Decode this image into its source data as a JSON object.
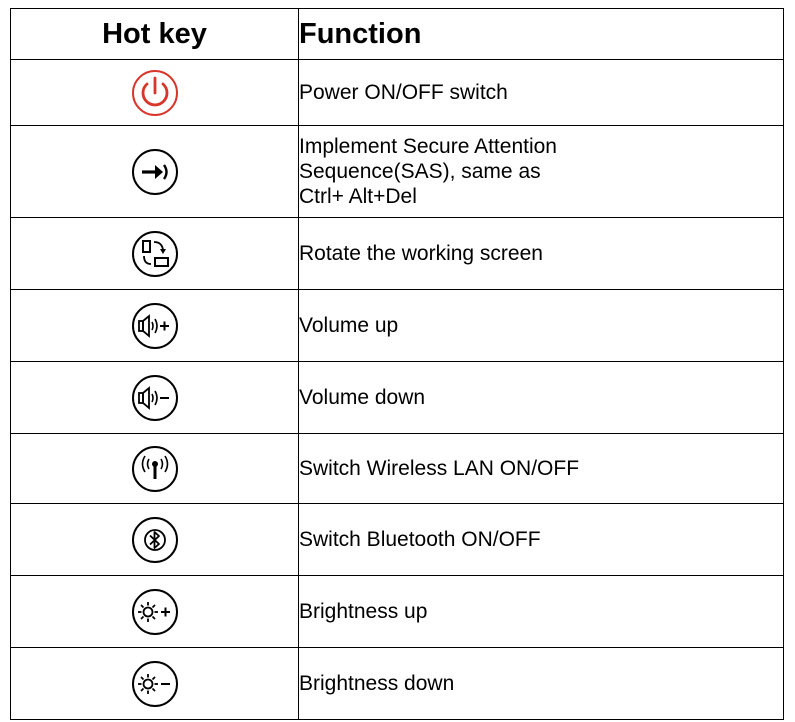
{
  "table": {
    "header": {
      "hotkey": "Hot key",
      "function": "Function"
    },
    "rows": [
      {
        "icon": "power-icon",
        "function": "Power ON/OFF switch"
      },
      {
        "icon": "secure-attention-sequence-icon",
        "function_lines": [
          "Implement Secure Attention",
          "Sequence(SAS), same as",
          "Ctrl+ Alt+Del"
        ]
      },
      {
        "icon": "rotate-screen-icon",
        "function": "Rotate the working screen"
      },
      {
        "icon": "volume-up-icon",
        "function": "Volume up"
      },
      {
        "icon": "volume-down-icon",
        "function": "Volume down"
      },
      {
        "icon": "wireless-lan-icon",
        "function": "Switch Wireless LAN ON/OFF"
      },
      {
        "icon": "bluetooth-icon",
        "function": "Switch Bluetooth ON/OFF"
      },
      {
        "icon": "brightness-up-icon",
        "function": "Brightness up"
      },
      {
        "icon": "brightness-down-icon",
        "function": "Brightness down"
      }
    ]
  },
  "colors": {
    "power_icon": "#d9362b",
    "line": "#000000",
    "background": "#ffffff"
  }
}
